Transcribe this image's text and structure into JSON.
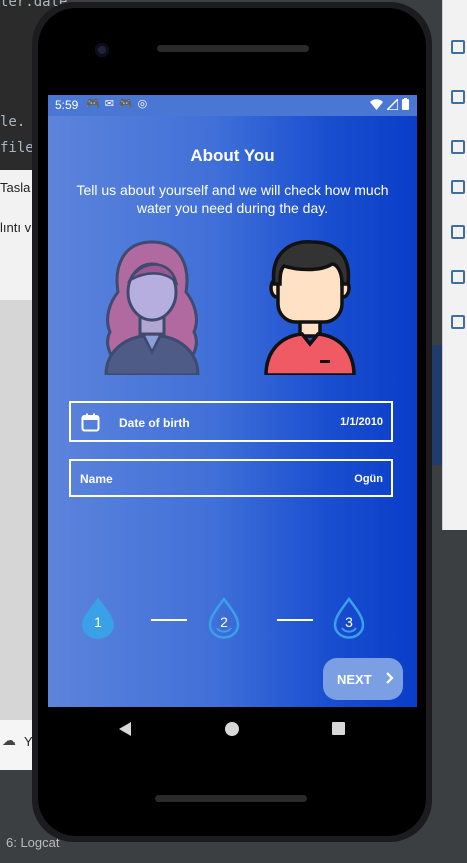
{
  "ide": {
    "code_line_1": "ter.date",
    "code_line_2": "le.",
    "code_line_3": "file",
    "panel_tab": "Tasla",
    "panel_text": "lıntı v",
    "bottom_text": "Y",
    "status_text": "6: Logcat"
  },
  "status_bar": {
    "time": "5:59"
  },
  "screen": {
    "title": "About You",
    "subtitle": "Tell us about yourself and we will check how much water you need during the day."
  },
  "form": {
    "dob_label": "Date of birth",
    "dob_value": "1/1/2010",
    "name_label": "Name",
    "name_value": "Ogün"
  },
  "stepper": {
    "steps": [
      "1",
      "2",
      "3"
    ],
    "current_step": 1
  },
  "next_button": {
    "label": "NEXT"
  },
  "colors": {
    "gradient_start": "#5d84db",
    "gradient_end": "#0a3dc8",
    "active_step": "#3aa0e8",
    "next_button": "#7aa0e3"
  }
}
